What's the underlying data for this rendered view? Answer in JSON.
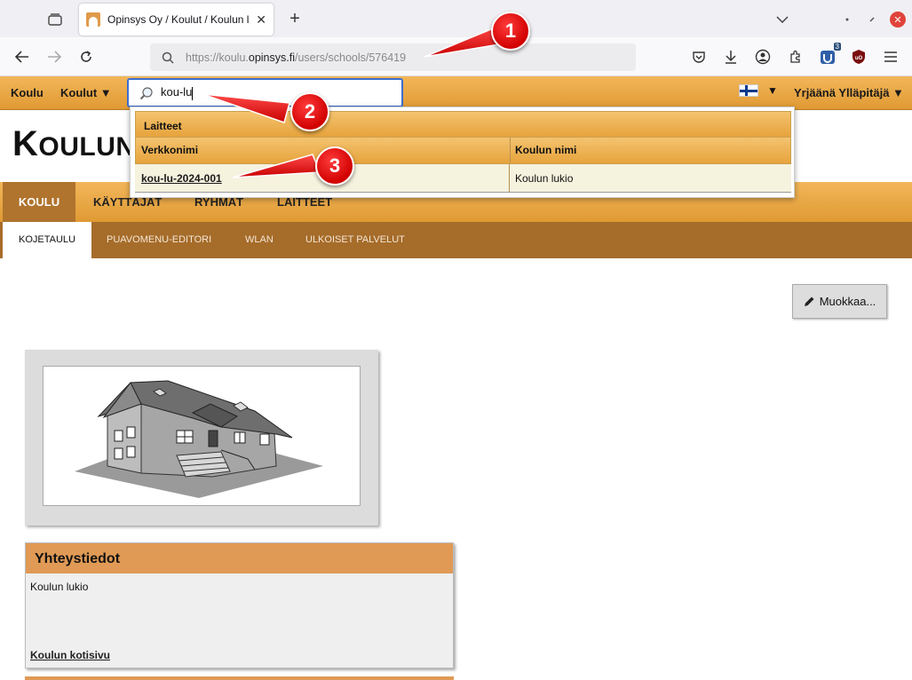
{
  "browser": {
    "tab_title": "Opinsys Oy / Koulut / Koulun lukio",
    "url_host_prefix": "https://koulu.",
    "url_domain": "opinsys.fi",
    "url_path": "/users/schools/576419",
    "extension_badge": "3",
    "new_tab": "+"
  },
  "sitebar": {
    "koulu": "Koulu",
    "koulut": "Koulut ▼",
    "search_value": "kou-lu",
    "lang_arrow": "▼",
    "user": "Yrjäänä Ylläpitäjä ▼"
  },
  "page": {
    "title_first": "K",
    "title_rest": "OULUN",
    "edit_button": "Muokkaa..."
  },
  "main_tabs": [
    "KOULU",
    "KÄYTTÄJÄT",
    "RYHMÄT",
    "LAITTEET"
  ],
  "sub_tabs": [
    "KOJETAULU",
    "PUAVOMENU-EDITORI",
    "WLAN",
    "ULKOISET PALVELUT"
  ],
  "dropdown": {
    "section": "Laitteet",
    "col_hostname": "Verkkonimi",
    "col_school": "Koulun nimi",
    "rows": [
      {
        "hostname": "kou-lu-2024-001",
        "school": "Koulun lukio"
      }
    ]
  },
  "card": {
    "title": "Yhteystiedot",
    "name": "Koulun lukio",
    "homepage_link": "Koulun kotisivu"
  },
  "callouts": [
    "1",
    "2",
    "3"
  ],
  "colors": {
    "accent_orange": "#e09a33",
    "active_tab": "#b0742e",
    "subtab_bar": "#a66c2a",
    "callout_red": "#d10000"
  }
}
